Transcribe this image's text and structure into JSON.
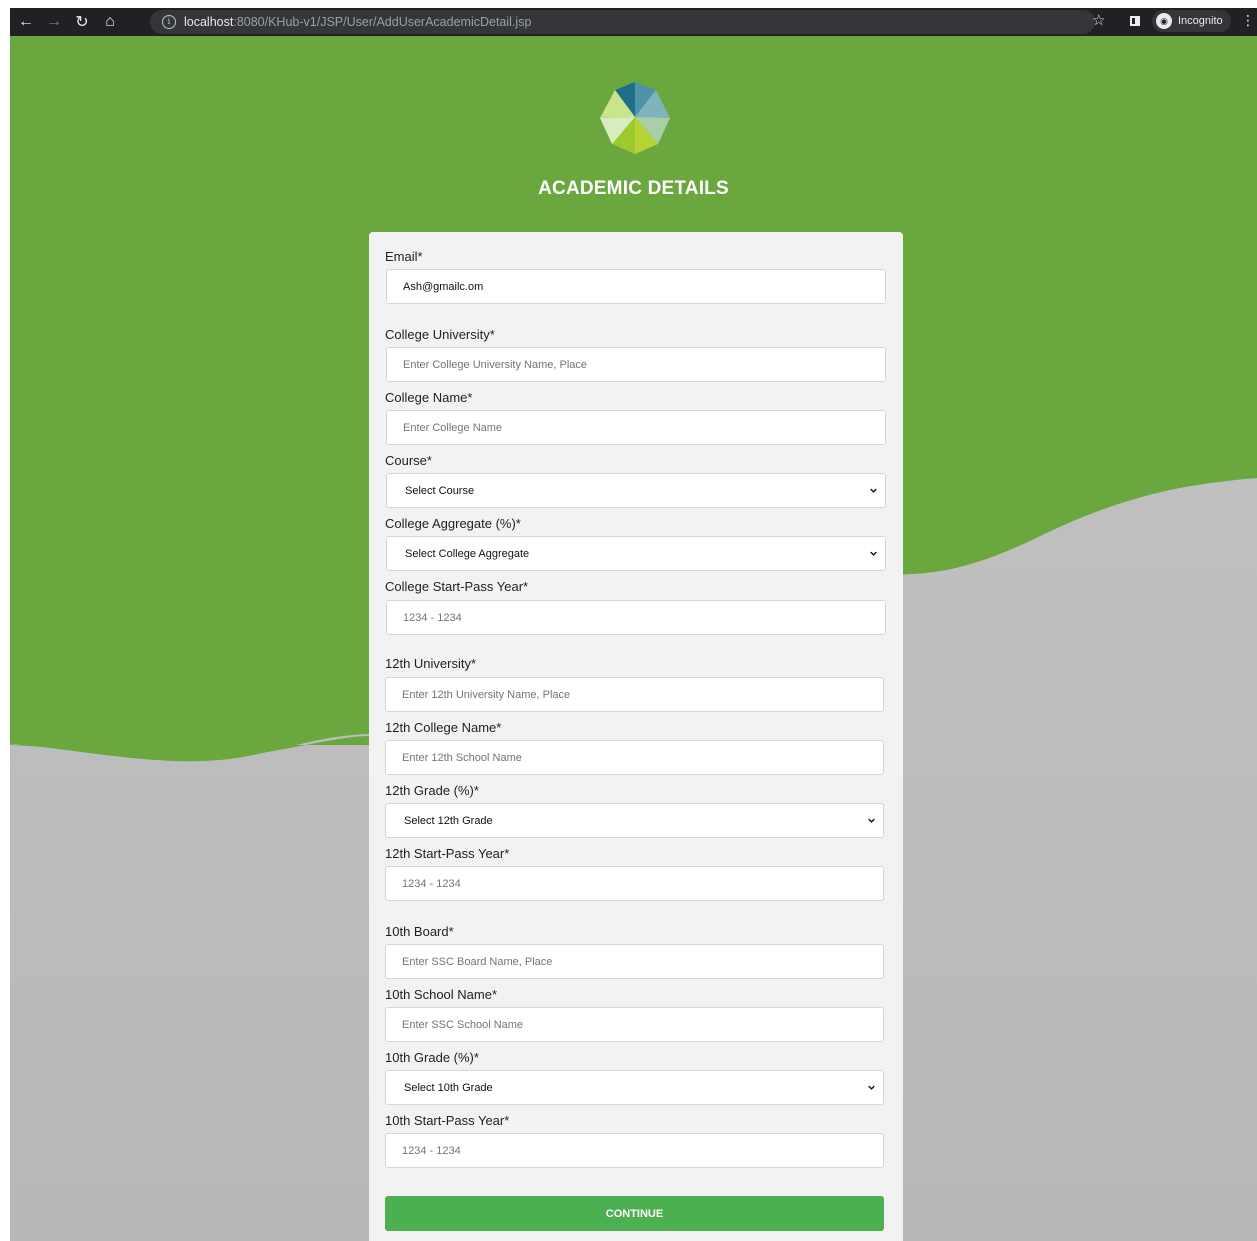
{
  "browser": {
    "url_host": "localhost",
    "url_path": ":8080/KHub-v1/JSP/User/AddUserAcademicDetail.jsp",
    "profile_label": "Incognito"
  },
  "page": {
    "title": "ACADEMIC DETAILS",
    "colors": {
      "green": "#6aa73f",
      "card": "#f2f2f2",
      "button": "#4caf50"
    }
  },
  "form": {
    "email": {
      "label": "Email*",
      "value": "Ash@gmailc.om"
    },
    "college_university": {
      "label": "College University*",
      "placeholder": "Enter College University Name, Place"
    },
    "college_name": {
      "label": "College Name*",
      "placeholder": "Enter College Name"
    },
    "course": {
      "label": "Course*",
      "selected": "Select Course"
    },
    "college_aggregate": {
      "label": "College Aggregate (%)*",
      "selected": "Select College Aggregate"
    },
    "college_year": {
      "label": "College Start-Pass Year*",
      "placeholder": "1234 - 1234"
    },
    "twelfth_university": {
      "label": "12th University*",
      "placeholder": "Enter 12th University Name, Place"
    },
    "twelfth_college": {
      "label": "12th College Name*",
      "placeholder": "Enter 12th School Name"
    },
    "twelfth_grade": {
      "label": "12th Grade (%)*",
      "selected": "Select 12th Grade"
    },
    "twelfth_year": {
      "label": "12th Start-Pass Year*",
      "placeholder": "1234 - 1234"
    },
    "tenth_board": {
      "label": "10th Board*",
      "placeholder": "Enter SSC Board Name, Place"
    },
    "tenth_school": {
      "label": "10th School Name*",
      "placeholder": "Enter SSC School Name"
    },
    "tenth_grade": {
      "label": "10th Grade (%)*",
      "selected": "Select 10th Grade"
    },
    "tenth_year": {
      "label": "10th Start-Pass Year*",
      "placeholder": "1234 - 1234"
    },
    "continue_label": "CONTINUE"
  }
}
